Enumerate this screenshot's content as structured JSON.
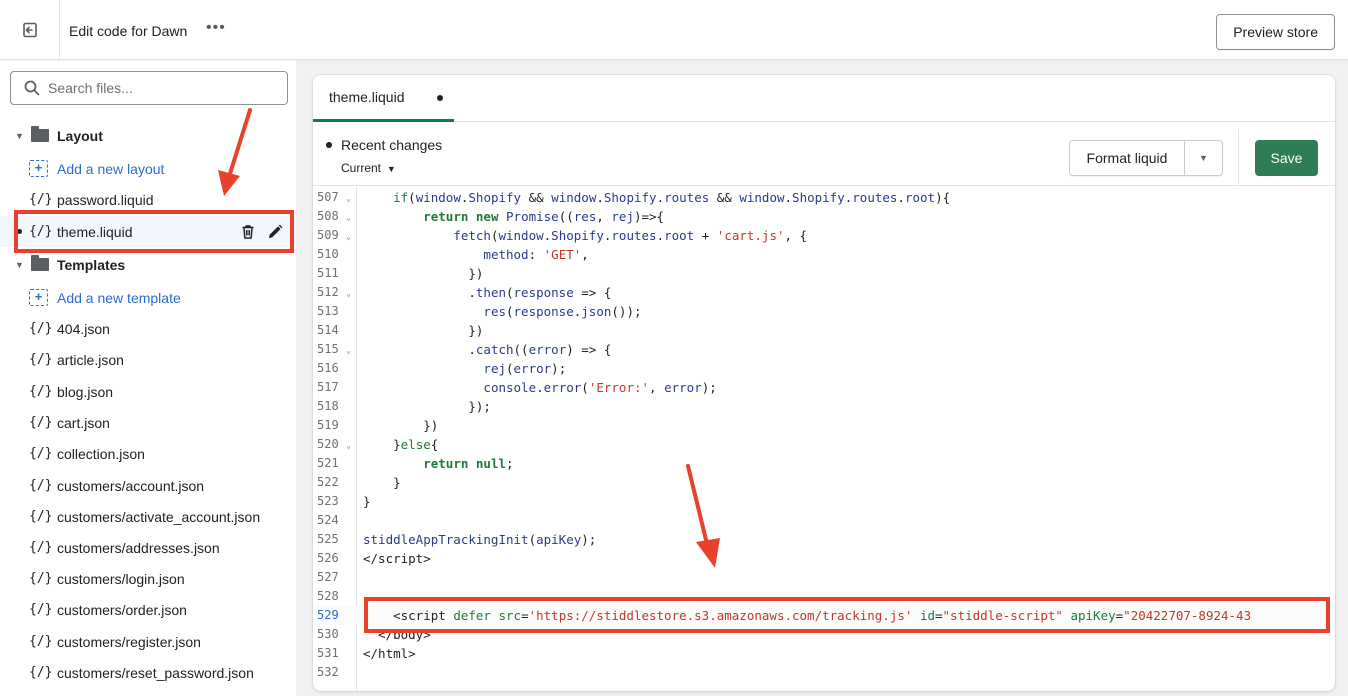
{
  "topbar": {
    "title": "Edit code for Dawn",
    "more": "•••",
    "preview_label": "Preview store"
  },
  "sidebar": {
    "search_placeholder": "Search files...",
    "layout_folder": "Layout",
    "add_layout": "Add a new layout",
    "password_file": "password.liquid",
    "theme_file": "theme.liquid",
    "templates_folder": "Templates",
    "add_template": "Add a new template",
    "template_files": [
      "404.json",
      "article.json",
      "blog.json",
      "cart.json",
      "collection.json",
      "customers/account.json",
      "customers/activate_account.json",
      "customers/addresses.json",
      "customers/login.json",
      "customers/order.json",
      "customers/register.json",
      "customers/reset_password.json"
    ],
    "file_icon": "{/}"
  },
  "editor": {
    "tab_label": "theme.liquid",
    "recent_changes": "Recent changes",
    "current_label": "Current",
    "format_label": "Format liquid",
    "save_label": "Save",
    "line_numbers": [
      "507",
      "508",
      "509",
      "510",
      "511",
      "512",
      "513",
      "514",
      "515",
      "516",
      "517",
      "518",
      "519",
      "520",
      "521",
      "522",
      "523",
      "524",
      "525",
      "526",
      "527",
      "528",
      "529",
      "530",
      "531",
      "532"
    ],
    "current_line": "529"
  },
  "colors": {
    "accent_green": "#2e7d54",
    "annotation_red": "#e8412c",
    "link_blue": "#2c6ecb"
  }
}
